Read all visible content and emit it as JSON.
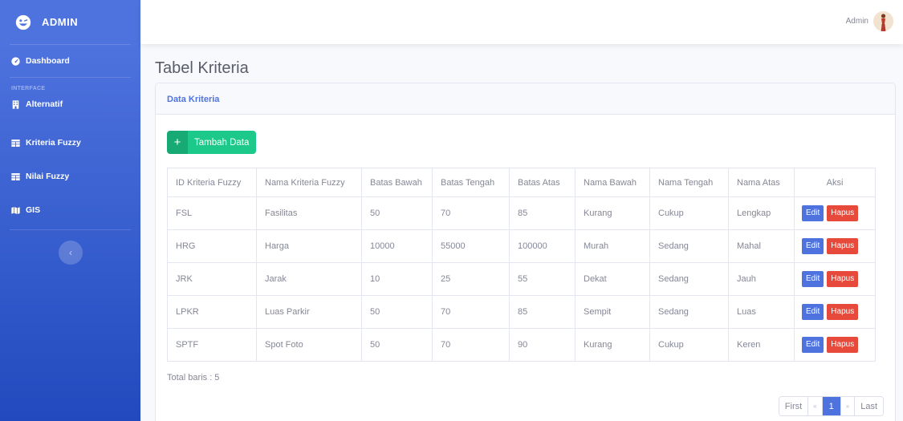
{
  "sidebar": {
    "brand": "ADMIN",
    "dashboard": "Dashboard",
    "heading": "INTERFACE",
    "items": [
      {
        "label": "Alternatif",
        "icon": "building-icon"
      },
      {
        "label": "Kriteria Fuzzy",
        "icon": "table-icon"
      },
      {
        "label": "Nilai Fuzzy",
        "icon": "table-icon"
      },
      {
        "label": "GIS",
        "icon": "map-icon"
      }
    ],
    "toggle": "‹"
  },
  "topbar": {
    "user_name": "Admin"
  },
  "page": {
    "title": "Tabel Kriteria"
  },
  "card": {
    "header": "Data Kriteria",
    "add_button_label": "Tambah Data",
    "add_button_icon": "+"
  },
  "table": {
    "headers": [
      "ID Kriteria Fuzzy",
      "Nama Kriteria Fuzzy",
      "Batas Bawah",
      "Batas Tengah",
      "Batas Atas",
      "Nama Bawah",
      "Nama Tengah",
      "Nama Atas",
      "Aksi"
    ],
    "rows": [
      [
        "FSL",
        "Fasilitas",
        "50",
        "70",
        "85",
        "Kurang",
        "Cukup",
        "Lengkap"
      ],
      [
        "HRG",
        "Harga",
        "10000",
        "55000",
        "100000",
        "Murah",
        "Sedang",
        "Mahal"
      ],
      [
        "JRK",
        "Jarak",
        "10",
        "25",
        "55",
        "Dekat",
        "Sedang",
        "Jauh"
      ],
      [
        "LPKR",
        "Luas Parkir",
        "50",
        "70",
        "85",
        "Sempit",
        "Sedang",
        "Luas"
      ],
      [
        "SPTF",
        "Spot Foto",
        "50",
        "70",
        "90",
        "Kurang",
        "Cukup",
        "Keren"
      ]
    ],
    "edit_label": "Edit",
    "delete_label": "Hapus"
  },
  "footer": {
    "total": "Total baris : 5",
    "pagination": {
      "first": "First",
      "prev": "«",
      "current": "1",
      "next": "»",
      "last": "Last"
    }
  },
  "colors": {
    "primary": "#4e73df",
    "success": "#1cc88a",
    "danger": "#e74a3b"
  }
}
